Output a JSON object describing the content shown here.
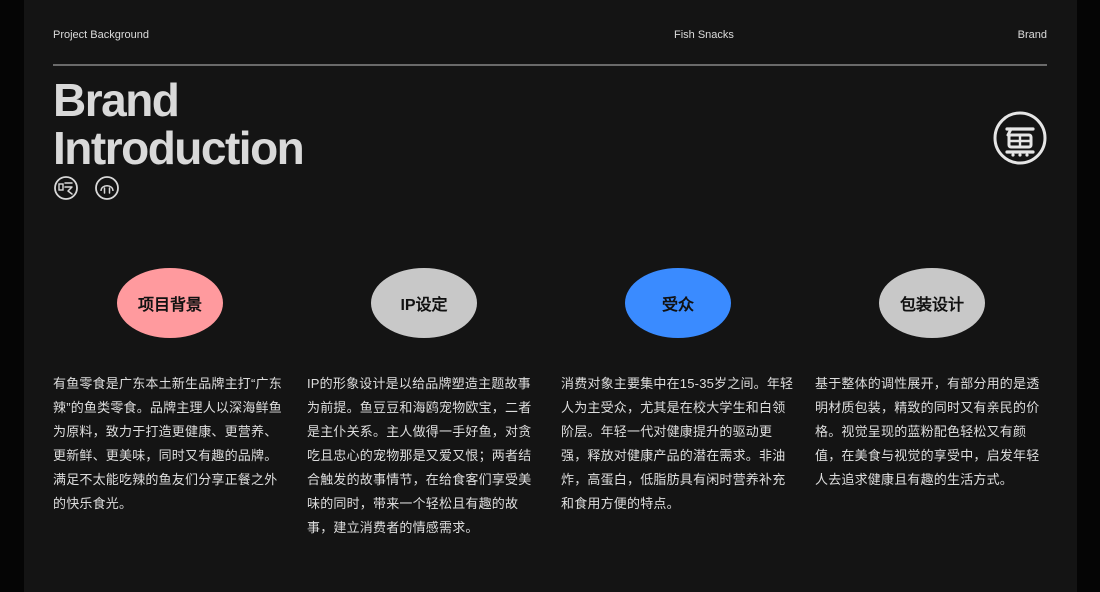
{
  "header": {
    "left": "Project Background",
    "center": "Fish Snacks",
    "right": "Brand"
  },
  "title": {
    "line1": "Brand",
    "line2": "Introduction"
  },
  "icons": {
    "mini_left": "chi-eat-badge-icon",
    "mini_right": "fish-face-badge-icon",
    "brand": "fish-character-logo-icon"
  },
  "colors": {
    "pink": "#ff9a9e",
    "gray": "#c8c8c8",
    "blue": "#3a8bff"
  },
  "sections": [
    {
      "label": "项目背景",
      "color": "#ff9a9e",
      "text": "有鱼零食是广东本土新生品牌主打“广东辣”的鱼类零食。品牌主理人以深海鲜鱼为原料，致力于打造更健康、更营养、更新鲜、更美味，同时又有趣的品牌。满足不太能吃辣的鱼友们分享正餐之外的快乐食光。"
    },
    {
      "label": "IP设定",
      "color": "#c8c8c8",
      "text": "IP的形象设计是以给品牌塑造主题故事为前提。鱼豆豆和海鸥宠物欧宝，二者是主仆关系。主人做得一手好鱼，对贪吃且忠心的宠物那是又爱又恨；两者结合触发的故事情节，在给食客们享受美味的同时，带来一个轻松且有趣的故事，建立消费者的情感需求。"
    },
    {
      "label": "受众",
      "color": "#3a8bff",
      "text": "消费对象主要集中在15-35岁之间。年轻人为主受众，尤其是在校大学生和白领阶层。年轻一代对健康提升的驱动更强，释放对健康产品的潜在需求。非油炸，高蛋白，低脂肪具有闲时营养补充和食用方便的特点。"
    },
    {
      "label": "包装设计",
      "color": "#c8c8c8",
      "text": "基于整体的调性展开，有部分用的是透明材质包装，精致的同时又有亲民的价格。视觉呈现的蓝粉配色轻松又有颜值，在美食与视觉的享受中，启发年轻人去追求健康且有趣的生活方式。"
    }
  ]
}
